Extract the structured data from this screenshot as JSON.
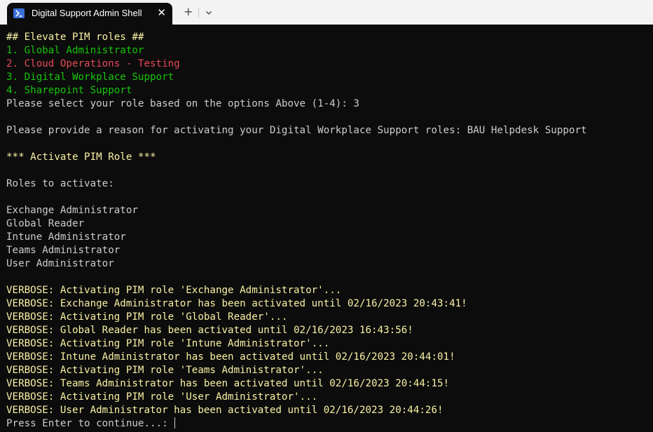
{
  "window": {
    "tab_title": "Digital Support Admin Shell",
    "tab_icon": "powershell-icon",
    "close_glyph": "✕",
    "new_tab_glyph": "+",
    "dropdown_icon": "chevron-down-icon"
  },
  "colors": {
    "background": "#0c0c0c",
    "text": "#cccccc",
    "yellow": "#f9f1a5",
    "green": "#16c60c",
    "red": "#e74856"
  },
  "terminal": {
    "lines": [
      {
        "text": "## Elevate PIM roles ##",
        "color": "yellow"
      },
      {
        "text": "1. Global Administrator",
        "color": "green"
      },
      {
        "text": "2. Cloud Operations - Testing",
        "color": "red"
      },
      {
        "text": "3. Digital Workplace Support",
        "color": "green"
      },
      {
        "text": "4. Sharepoint Support",
        "color": "green"
      },
      {
        "text": "Please select your role based on the options Above (1-4): 3",
        "color": "white"
      },
      {
        "text": "",
        "color": "white"
      },
      {
        "text": "Please provide a reason for activating your Digital Workplace Support roles: BAU Helpdesk Support",
        "color": "white"
      },
      {
        "text": "",
        "color": "white"
      },
      {
        "text": "*** Activate PIM Role ***",
        "color": "yellow"
      },
      {
        "text": "",
        "color": "white"
      },
      {
        "text": "Roles to activate:",
        "color": "white"
      },
      {
        "text": "",
        "color": "white"
      },
      {
        "text": "Exchange Administrator",
        "color": "white"
      },
      {
        "text": "Global Reader",
        "color": "white"
      },
      {
        "text": "Intune Administrator",
        "color": "white"
      },
      {
        "text": "Teams Administrator",
        "color": "white"
      },
      {
        "text": "User Administrator",
        "color": "white"
      },
      {
        "text": "",
        "color": "white"
      },
      {
        "text": "VERBOSE: Activating PIM role 'Exchange Administrator'...",
        "color": "yellow"
      },
      {
        "text": "VERBOSE: Exchange Administrator has been activated until 02/16/2023 20:43:41!",
        "color": "yellow"
      },
      {
        "text": "VERBOSE: Activating PIM role 'Global Reader'...",
        "color": "yellow"
      },
      {
        "text": "VERBOSE: Global Reader has been activated until 02/16/2023 16:43:56!",
        "color": "yellow"
      },
      {
        "text": "VERBOSE: Activating PIM role 'Intune Administrator'...",
        "color": "yellow"
      },
      {
        "text": "VERBOSE: Intune Administrator has been activated until 02/16/2023 20:44:01!",
        "color": "yellow"
      },
      {
        "text": "VERBOSE: Activating PIM role 'Teams Administrator'...",
        "color": "yellow"
      },
      {
        "text": "VERBOSE: Teams Administrator has been activated until 02/16/2023 20:44:15!",
        "color": "yellow"
      },
      {
        "text": "VERBOSE: Activating PIM role 'User Administrator'...",
        "color": "yellow"
      },
      {
        "text": "VERBOSE: User Administrator has been activated until 02/16/2023 20:44:26!",
        "color": "yellow"
      }
    ],
    "prompt": "Press Enter to continue...: "
  }
}
